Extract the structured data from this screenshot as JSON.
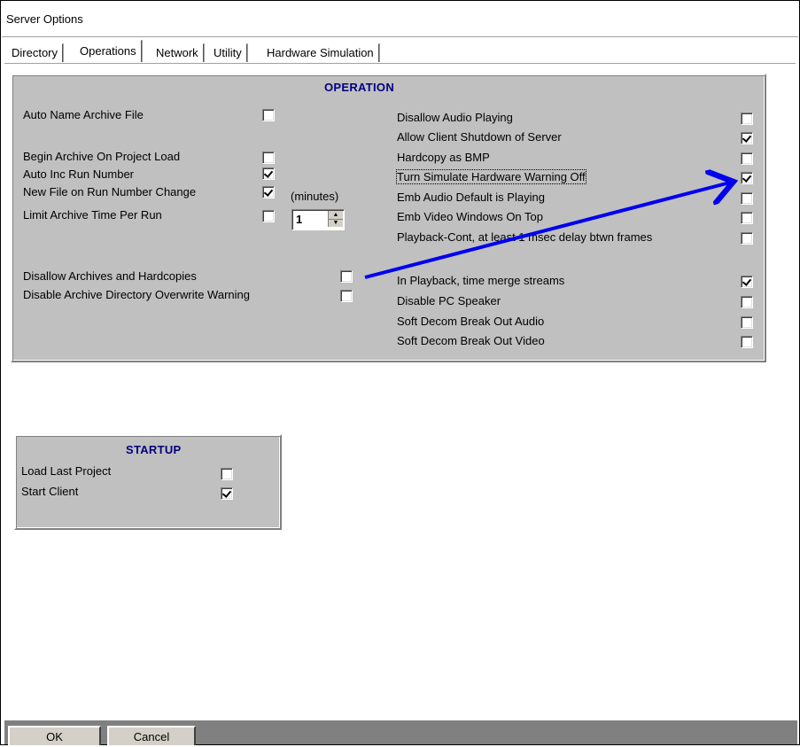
{
  "window": {
    "title": "Server Options"
  },
  "tabs": [
    {
      "label": "Directory"
    },
    {
      "label": "Operations",
      "active": true
    },
    {
      "label": "Network"
    },
    {
      "label": "Utility"
    },
    {
      "label": "Hardware Simulation"
    }
  ],
  "operation": {
    "title": "OPERATION",
    "left_items": [
      {
        "label": "Auto Name Archive File",
        "checked": false
      },
      {
        "label": "Begin Archive On Project Load",
        "checked": false
      },
      {
        "label": "Auto Inc Run Number",
        "checked": true
      },
      {
        "label": "New File on Run Number Change",
        "checked": true
      },
      {
        "label": "Limit Archive Time Per Run",
        "checked": false
      },
      {
        "label": "Disallow Archives and Hardcopies",
        "checked": false
      },
      {
        "label": "Disable Archive Directory Overwrite Warning",
        "checked": false
      }
    ],
    "minutes_label": "(minutes)",
    "minutes_value": "1",
    "right_items": [
      {
        "label": "Disallow Audio Playing",
        "checked": false
      },
      {
        "label": "Allow Client Shutdown of Server",
        "checked": true
      },
      {
        "label": "Hardcopy as BMP",
        "checked": false
      },
      {
        "label": "Turn Simulate Hardware Warning Off",
        "checked": true
      },
      {
        "label": "Emb Audio  Default is Playing",
        "checked": false
      },
      {
        "label": "Emb Video Windows On Top",
        "checked": false
      },
      {
        "label": "Playback-Cont, at least  1 msec delay btwn frames",
        "checked": false
      },
      {
        "label": "In Playback, time merge streams",
        "checked": true
      },
      {
        "label": "Disable PC Speaker",
        "checked": false
      },
      {
        "label": "Soft Decom Break Out Audio",
        "checked": false
      },
      {
        "label": "Soft Decom Break Out Video",
        "checked": false
      }
    ]
  },
  "startup": {
    "title": "STARTUP",
    "items": [
      {
        "label": "Load Last Project",
        "checked": false
      },
      {
        "label": "Start Client",
        "checked": true
      }
    ]
  },
  "buttons": {
    "ok": "OK",
    "cancel": "Cancel"
  },
  "colors": {
    "group_bg": "#c0c0c0",
    "group_title": "#000080",
    "annotation_arrow": "#0000ee"
  }
}
